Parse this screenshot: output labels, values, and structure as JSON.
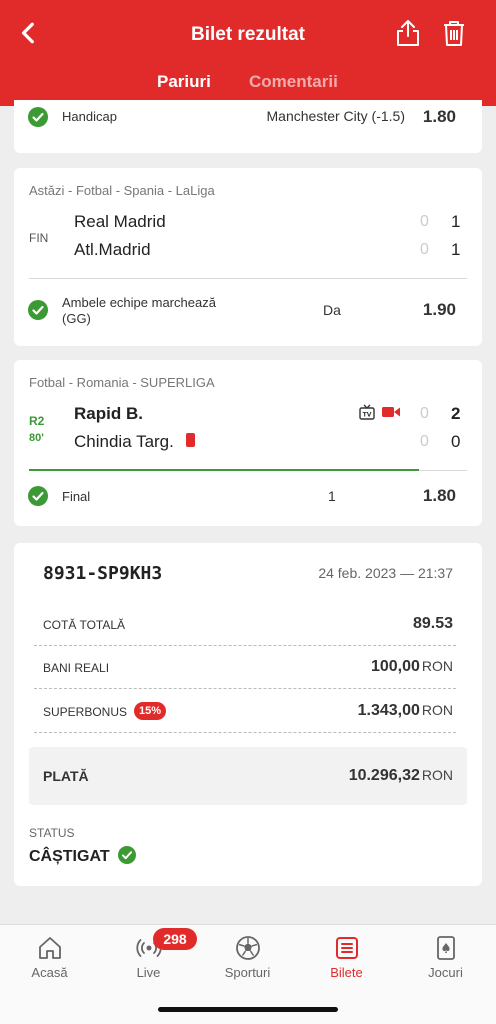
{
  "header": {
    "title": "Bilet rezultat",
    "tabs": [
      {
        "label": "Pariuri",
        "active": true
      },
      {
        "label": "Comentarii",
        "active": false
      }
    ],
    "icons": [
      "chevron-left-icon",
      "share-icon",
      "trash-icon"
    ]
  },
  "bets": [
    {
      "market": "Handicap",
      "pick": "Manchester City (-1.5)",
      "odds": "1.80"
    },
    {
      "league": "Astăzi - Fotbal - Spania - LaLiga",
      "status": "FIN",
      "home": {
        "name": "Real Madrid",
        "ht": "0",
        "ft": "1"
      },
      "away": {
        "name": "Atl.Madrid",
        "ht": "0",
        "ft": "1"
      },
      "market": "Ambele echipe marchează (GG)",
      "pick": "Da",
      "odds": "1.90"
    },
    {
      "league": "Fotbal - Romania - SUPERLIGA",
      "period": "R2",
      "minute": "80'",
      "home": {
        "name": "Rapid B.",
        "ht": "0",
        "ft": "2"
      },
      "away": {
        "name": "Chindia Targ.",
        "ht": "0",
        "ft": "0"
      },
      "market": "Final",
      "pick": "1",
      "odds": "1.80",
      "progress": 0.89
    }
  ],
  "ticket": {
    "id": "8931-SP9KH3",
    "date": "24 feb. 2023 — 21:37",
    "total_odds_label": "COTĂ TOTALĂ",
    "total_odds": "89.53",
    "stake_label": "BANI REALI",
    "stake": "100,00",
    "bonus_label": "SUPERBONUS",
    "bonus_pct": "15%",
    "bonus": "1.343,00",
    "currency": "RON",
    "payout_label": "PLATĂ",
    "payout": "10.296,32",
    "status_label": "STATUS",
    "status": "CÂȘTIGAT"
  },
  "nav": {
    "items": [
      {
        "label": "Acasă",
        "icon": "home-icon",
        "active": false
      },
      {
        "label": "Live",
        "icon": "live-icon",
        "active": false
      },
      {
        "label": "Sporturi",
        "icon": "soccer-ball-icon",
        "active": false
      },
      {
        "label": "Bilete",
        "icon": "ticket-icon",
        "active": true
      },
      {
        "label": "Jocuri",
        "icon": "cards-icon",
        "active": false
      }
    ],
    "live_count": "298"
  },
  "colors": {
    "brand": "#e12b2b",
    "success": "#3c9a35",
    "background": "#eeeeee"
  }
}
